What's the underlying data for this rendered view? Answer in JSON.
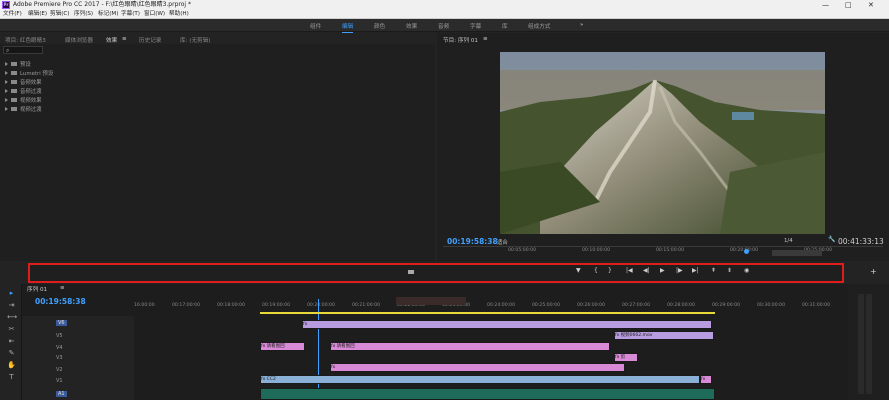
{
  "titlebar": {
    "icon_text": "Pr",
    "title": "Adobe Premiere Pro CC 2017 - F:\\红色眼睛\\红色眼睛3.prproj *",
    "min": "—",
    "max": "□",
    "close": "✕"
  },
  "menu": [
    "文件(F)",
    "编辑(E)",
    "剪辑(C)",
    "序列(S)",
    "标记(M)",
    "字幕(T)",
    "窗口(W)",
    "帮助(H)"
  ],
  "workspace": {
    "tabs": [
      "组件",
      "编辑",
      "颜色",
      "效果",
      "音频",
      "字幕",
      "库",
      "组成方式"
    ],
    "active": "编辑",
    "more": "»"
  },
  "project_panel": {
    "tabs": [
      "项目: 红色眼睛3",
      "媒体浏览器",
      "效果",
      "历史记录",
      "库: (无剪辑)"
    ],
    "active_tab": "效果",
    "menu_icon": "≡",
    "search_icon": "⌕",
    "effects_list": [
      "预设",
      "Lumetri 预设",
      "音频效果",
      "音频过渡",
      "视频效果",
      "视频过渡"
    ]
  },
  "program_monitor": {
    "title": "节目: 序列 01",
    "menu_icon": "≡",
    "timecode": "00:19:58:38",
    "fit": "适合",
    "fraction": "1/4",
    "duration": "00:41:33:13",
    "ruler": [
      "00:05:00:00",
      "00:10:00:00",
      "00:15:00:00",
      "00:20:00:00",
      "00:25:00:00"
    ]
  },
  "transport": {
    "marker": "▼",
    "in": "{",
    "out": "}",
    "go_in": "|◀",
    "step_back": "◀|",
    "play": "▶",
    "step_fwd": "|▶",
    "go_out": "▶|",
    "lift": "⇞",
    "extract": "⇟",
    "export_frame": "◉",
    "add": "+",
    "wrench": "🔧"
  },
  "timeline": {
    "seq_tab": "序列 01",
    "seq_menu": "≡",
    "timecode": "00:19:58:38",
    "ruler": [
      "16:00:00",
      "00:17:00:00",
      "00:18:00:00",
      "00:19:00:00",
      "00:20:00:00",
      "00:21:00:00",
      "00:22:00:00",
      "00:23:00:00",
      "00:24:00:00",
      "00:25:00:00",
      "00:26:00:00",
      "00:27:00:00",
      "00:28:00:00",
      "00:29:00:00",
      "00:30:00:00",
      "00:31:00:00"
    ],
    "tracks": [
      "V6",
      "V5",
      "V4",
      "V3",
      "V2",
      "V1",
      "A1"
    ],
    "selected_track": "V6",
    "clip_labels": [
      "fx",
      "fx 请看图回",
      "fx 请看图回",
      "fx 视频0662.mov",
      "fx 剪",
      "fx CC2",
      "fx",
      "fx"
    ],
    "tools": [
      "▸",
      "⇥",
      "⟷",
      "✂",
      "⇤",
      "✎",
      "✋",
      "T"
    ]
  },
  "colors": {
    "accent_blue": "#3ea0ff",
    "highlight_red": "#e11c1c",
    "clip_purple": "#b89ce0",
    "clip_pink": "#d98ad6",
    "clip_blue": "#8ab0d8",
    "audio_green": "#1f6b5a"
  }
}
